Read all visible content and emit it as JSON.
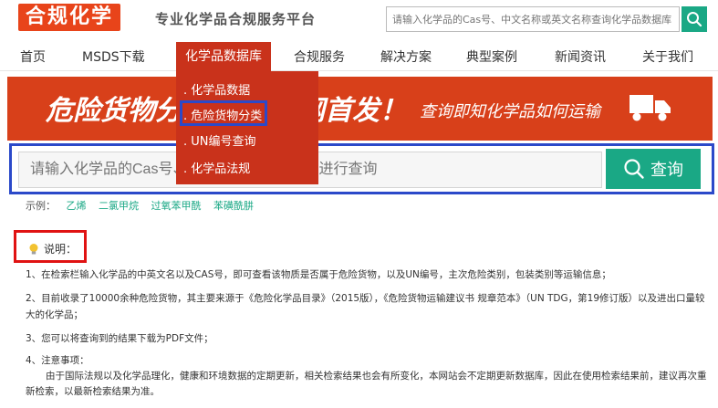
{
  "header": {
    "logo": "合规化学",
    "slogan": "专业化学品合规服务平台",
    "search_placeholder": "请输入化学品的Cas号、中文名称或英文名称查询化学品数据库"
  },
  "nav": {
    "items": [
      "首页",
      "MSDS下载",
      "化学品数据库",
      "合规服务",
      "解决方案",
      "典型案例",
      "新闻资讯",
      "关于我们"
    ],
    "active_index": 2
  },
  "dropdown": {
    "items": [
      "化学品数据",
      "危险货物分类",
      "UN编号查询",
      "化学品法规"
    ],
    "highlighted_index": 1
  },
  "banner": {
    "text_left": "危险货物分",
    "text_mid": "网首发！",
    "text_right": "查询即知化学品如何运输"
  },
  "search": {
    "placeholder": "请输入化学品的Cas号、中文名称或英文名称进行查询",
    "button_label": "查询"
  },
  "examples": {
    "label": "示例：",
    "items": [
      "乙烯",
      "二氯甲烷",
      "过氧苯甲酰",
      "苯磺酰肼"
    ]
  },
  "note": {
    "title": "说明：",
    "paragraphs": [
      "1、在检索栏输入化学品的中英文名以及CAS号，即可查看该物质是否属于危险货物，以及UN编号，主次危险类别，包装类别等运输信息；",
      "2、目前收录了10000余种危险货物，其主要来源于《危险化学品目录》（2015版），《危险货物运输建议书 规章范本》（UN TDG，第19修订版）以及进出口量较大的化学品；",
      "3、您可以将查询到的结果下载为PDF文件；",
      "4、注意事项：",
      "由于国际法规以及化学品理化，健康和环境数据的定期更新，相关检索结果也会有所变化，本网站会不定期更新数据库，因此在使用检索结果前，建议再次重新检索，以最新检索结果为准。"
    ]
  },
  "colors": {
    "brand_red": "#c9321b",
    "banner_orange": "#d8401a",
    "accent_green": "#1aa885",
    "highlight_blue": "#2b49c9",
    "highlight_red": "#e01212"
  }
}
